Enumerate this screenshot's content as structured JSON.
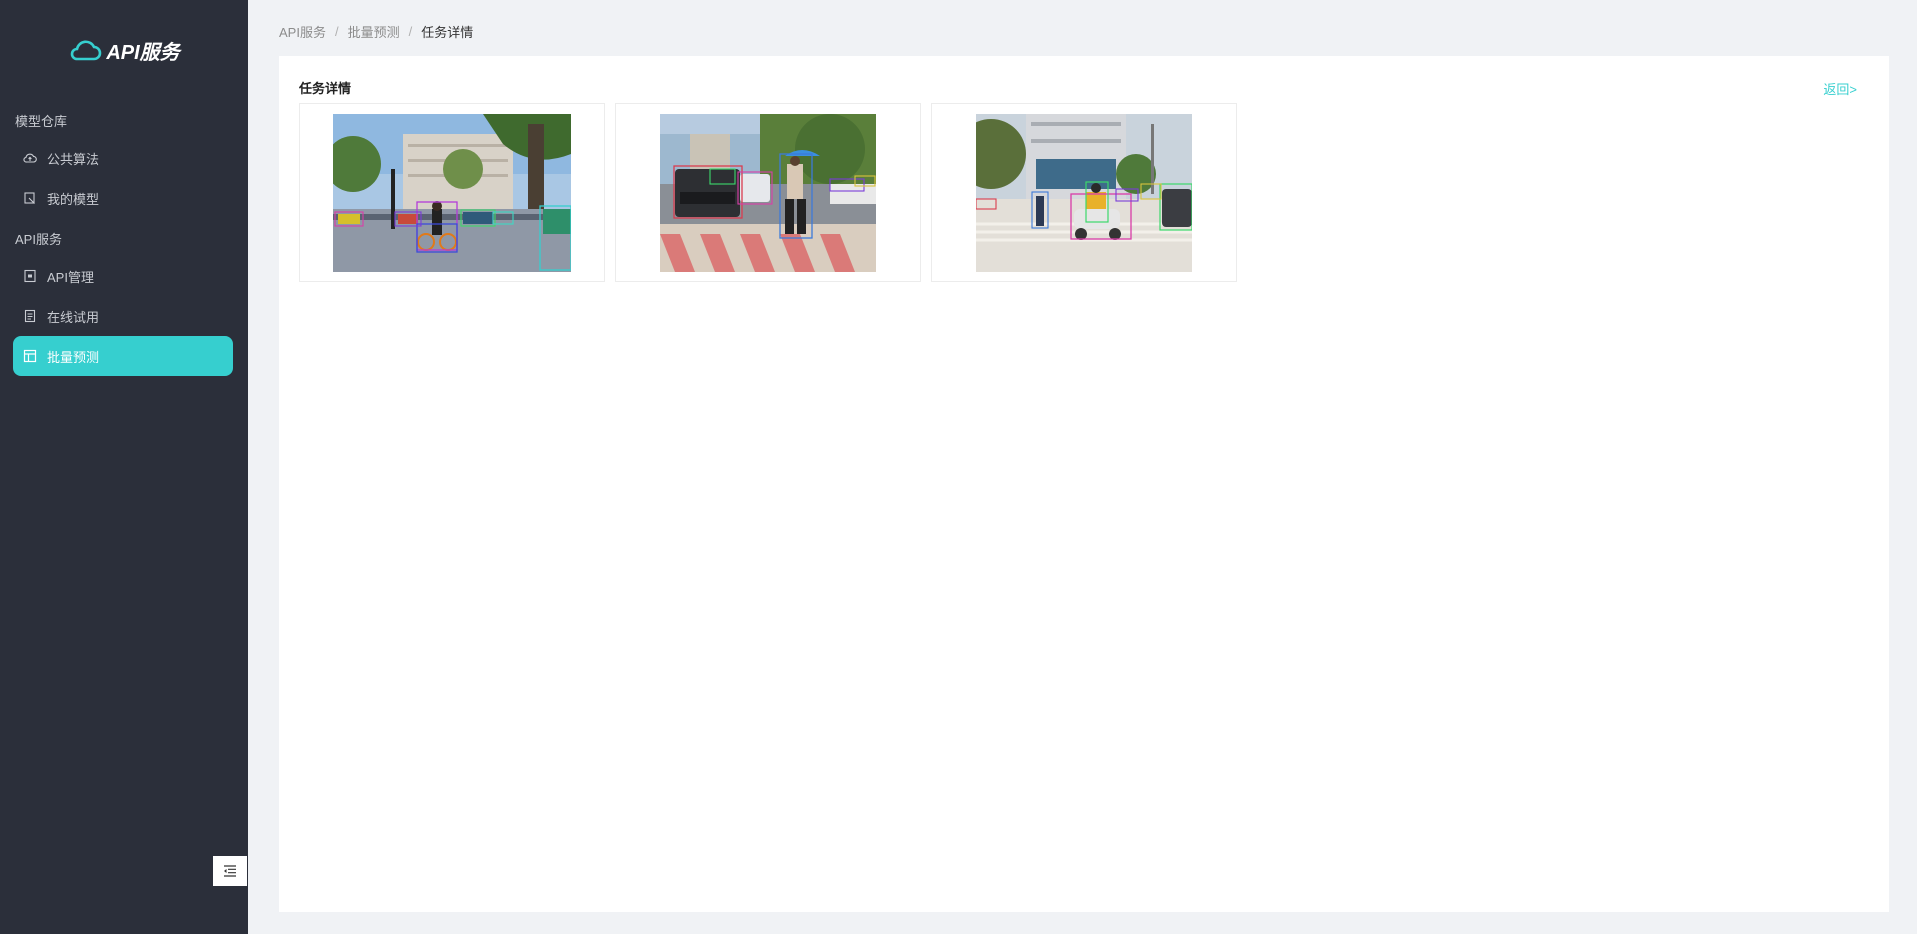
{
  "app": {
    "title": "API服务"
  },
  "sidebar": {
    "groups": [
      {
        "label": "模型仓库",
        "items": [
          {
            "label": "公共算法",
            "icon": "cloud-upload-icon"
          },
          {
            "label": "我的模型",
            "icon": "model-icon"
          }
        ]
      },
      {
        "label": "API服务",
        "items": [
          {
            "label": "API管理",
            "icon": "api-icon"
          },
          {
            "label": "在线试用",
            "icon": "document-icon"
          },
          {
            "label": "批量预测",
            "icon": "layout-icon",
            "active": true
          }
        ]
      }
    ]
  },
  "breadcrumb": [
    "API服务",
    "批量预测",
    "任务详情"
  ],
  "main": {
    "title": "任务详情",
    "back_label": "返回>"
  },
  "results": [
    {
      "scene": "street with cyclist and cars"
    },
    {
      "scene": "crosswalk with pedestrian holding umbrella and SUV"
    },
    {
      "scene": "intersection with scooter rider and pedestrians"
    }
  ],
  "colors": {
    "sidebar_bg": "#2b2f3a",
    "accent": "#36cfcf",
    "page_bg": "#f0f2f5"
  }
}
